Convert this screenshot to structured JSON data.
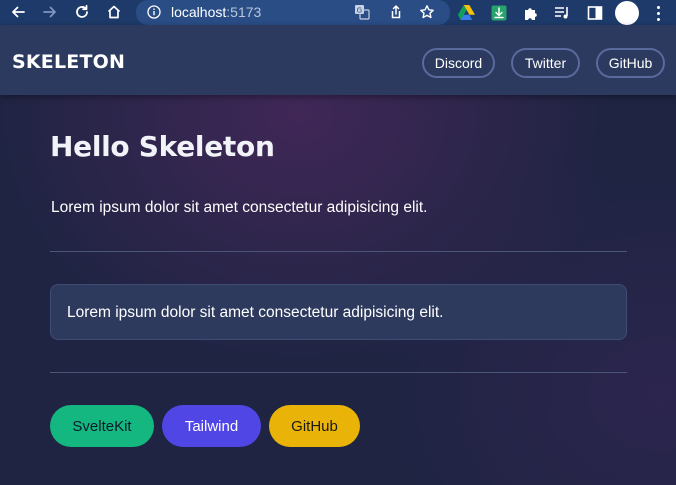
{
  "browser": {
    "url_host": "localhost",
    "url_port": ":5173"
  },
  "header": {
    "brand": "SKELETON",
    "links": [
      {
        "label": "Discord"
      },
      {
        "label": "Twitter"
      },
      {
        "label": "GitHub"
      }
    ]
  },
  "main": {
    "title": "Hello Skeleton",
    "intro": "Lorem ipsum dolor sit amet consectetur adipisicing elit.",
    "card_text": "Lorem ipsum dolor sit amet consectetur adipisicing elit.",
    "buttons": [
      {
        "label": "SvelteKit",
        "color": "#14b77f",
        "text_color": "#0d1a2a"
      },
      {
        "label": "Tailwind",
        "color": "#4f46e5",
        "text_color": "#ffffff"
      },
      {
        "label": "GitHub",
        "color": "#eab308",
        "text_color": "#1a1a1a"
      }
    ]
  },
  "colors": {
    "browser_bar": "#1d3a6a",
    "header_bg": "#2b3a5e",
    "page_bg": "#1e2442",
    "card_bg": "#2d3a5e"
  }
}
